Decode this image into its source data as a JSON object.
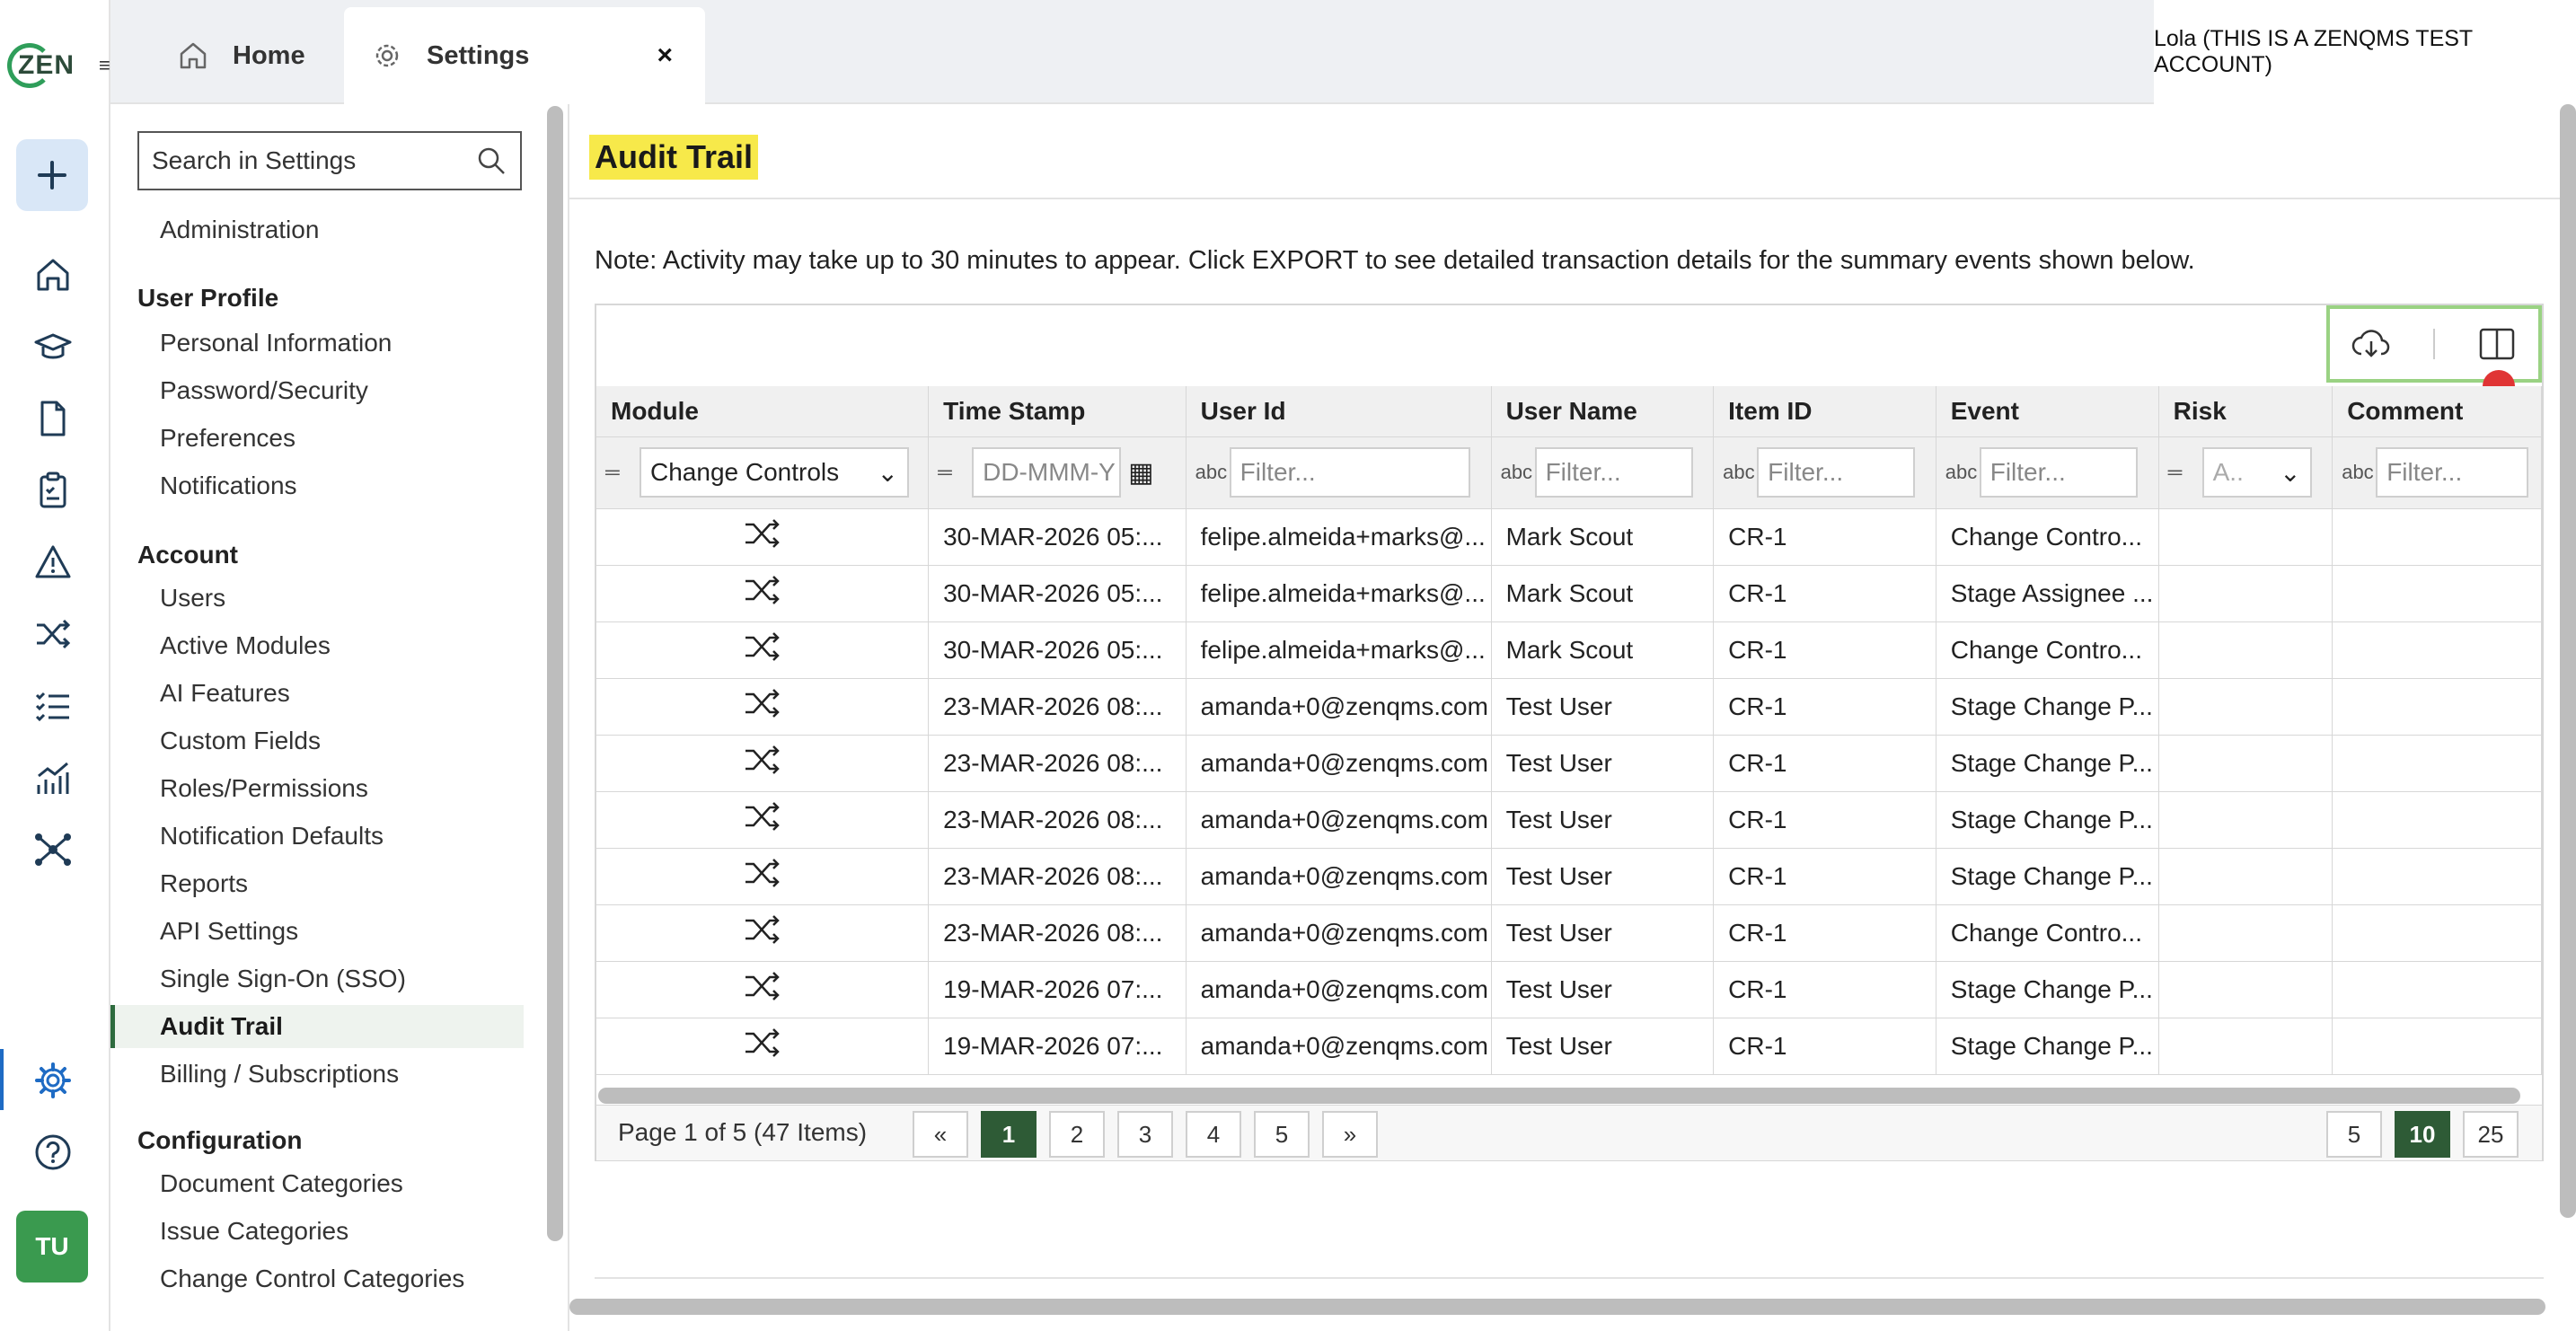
{
  "app": {
    "logo_text": "ZEN",
    "account_label": "Lola (THIS IS A ZENQMS TEST ACCOUNT)",
    "avatar_initials": "TU"
  },
  "tabs": [
    {
      "label": "Home",
      "icon": "home-icon"
    },
    {
      "label": "Settings",
      "icon": "gear-icon",
      "close": "×"
    }
  ],
  "rail_icons": [
    "plus-icon",
    "home-icon",
    "graduation-cap-icon",
    "document-icon",
    "clipboard-icon",
    "warning-icon",
    "shuffle-icon",
    "checklist-icon",
    "chart-icon",
    "network-icon",
    "gear-icon",
    "help-icon"
  ],
  "sidebar": {
    "search_placeholder": "Search in Settings",
    "top_item": "Administration",
    "sections": [
      {
        "title": "User Profile",
        "items": [
          "Personal Information",
          "Password/Security",
          "Preferences",
          "Notifications"
        ]
      },
      {
        "title": "Account",
        "items": [
          "Users",
          "Active Modules",
          "AI Features",
          "Custom Fields",
          "Roles/Permissions",
          "Notification Defaults",
          "Reports",
          "API Settings",
          "Single Sign-On (SSO)",
          "Audit Trail",
          "Billing / Subscriptions"
        ]
      },
      {
        "title": "Configuration",
        "items": [
          "Document Categories",
          "Issue Categories",
          "Change Control Categories"
        ]
      }
    ],
    "active_item": "Audit Trail"
  },
  "main": {
    "title": "Audit Trail",
    "note": "Note: Activity may take up to 30 minutes to appear. Click EXPORT to see detailed transaction details for the summary events shown below."
  },
  "grid": {
    "toolbar_icons": [
      "cloud-download-icon",
      "columns-icon"
    ],
    "columns": [
      "Module",
      "Time Stamp",
      "User Id",
      "User Name",
      "Item ID",
      "Event",
      "Risk",
      "Comment"
    ],
    "filters": {
      "module": "Change Controls",
      "timestamp_placeholder": "DD-MMM-Y",
      "text_placeholder": "Filter...",
      "risk_placeholder": "A.."
    },
    "rows": [
      {
        "timestamp": "30-MAR-2026 05:...",
        "user_id": "felipe.almeida+marks@...",
        "user_name": "Mark Scout",
        "item_id": "CR-1",
        "event": "Change Contro...",
        "risk": "",
        "comment": ""
      },
      {
        "timestamp": "30-MAR-2026 05:...",
        "user_id": "felipe.almeida+marks@...",
        "user_name": "Mark Scout",
        "item_id": "CR-1",
        "event": "Stage Assignee ...",
        "risk": "",
        "comment": ""
      },
      {
        "timestamp": "30-MAR-2026 05:...",
        "user_id": "felipe.almeida+marks@...",
        "user_name": "Mark Scout",
        "item_id": "CR-1",
        "event": "Change Contro...",
        "risk": "",
        "comment": ""
      },
      {
        "timestamp": "23-MAR-2026 08:...",
        "user_id": "amanda+0@zenqms.com",
        "user_name": "Test User",
        "item_id": "CR-1",
        "event": "Stage Change P...",
        "risk": "",
        "comment": ""
      },
      {
        "timestamp": "23-MAR-2026 08:...",
        "user_id": "amanda+0@zenqms.com",
        "user_name": "Test User",
        "item_id": "CR-1",
        "event": "Stage Change P...",
        "risk": "",
        "comment": ""
      },
      {
        "timestamp": "23-MAR-2026 08:...",
        "user_id": "amanda+0@zenqms.com",
        "user_name": "Test User",
        "item_id": "CR-1",
        "event": "Stage Change P...",
        "risk": "",
        "comment": ""
      },
      {
        "timestamp": "23-MAR-2026 08:...",
        "user_id": "amanda+0@zenqms.com",
        "user_name": "Test User",
        "item_id": "CR-1",
        "event": "Stage Change P...",
        "risk": "",
        "comment": ""
      },
      {
        "timestamp": "23-MAR-2026 08:...",
        "user_id": "amanda+0@zenqms.com",
        "user_name": "Test User",
        "item_id": "CR-1",
        "event": "Change Contro...",
        "risk": "",
        "comment": ""
      },
      {
        "timestamp": "19-MAR-2026 07:...",
        "user_id": "amanda+0@zenqms.com",
        "user_name": "Test User",
        "item_id": "CR-1",
        "event": "Stage Change P...",
        "risk": "",
        "comment": ""
      },
      {
        "timestamp": "19-MAR-2026 07:...",
        "user_id": "amanda+0@zenqms.com",
        "user_name": "Test User",
        "item_id": "CR-1",
        "event": "Stage Change P...",
        "risk": "",
        "comment": ""
      }
    ],
    "pager": {
      "info": "Page 1 of 5 (47 Items)",
      "prev": "«",
      "pages": [
        "1",
        "2",
        "3",
        "4",
        "5"
      ],
      "next": "»",
      "current_page": "1",
      "page_sizes": [
        "5",
        "10",
        "25"
      ],
      "current_size": "10"
    }
  },
  "colors": {
    "accent": "#2e5b36",
    "highlight": "#f7e94a",
    "toolbar_border": "#9ad283"
  }
}
